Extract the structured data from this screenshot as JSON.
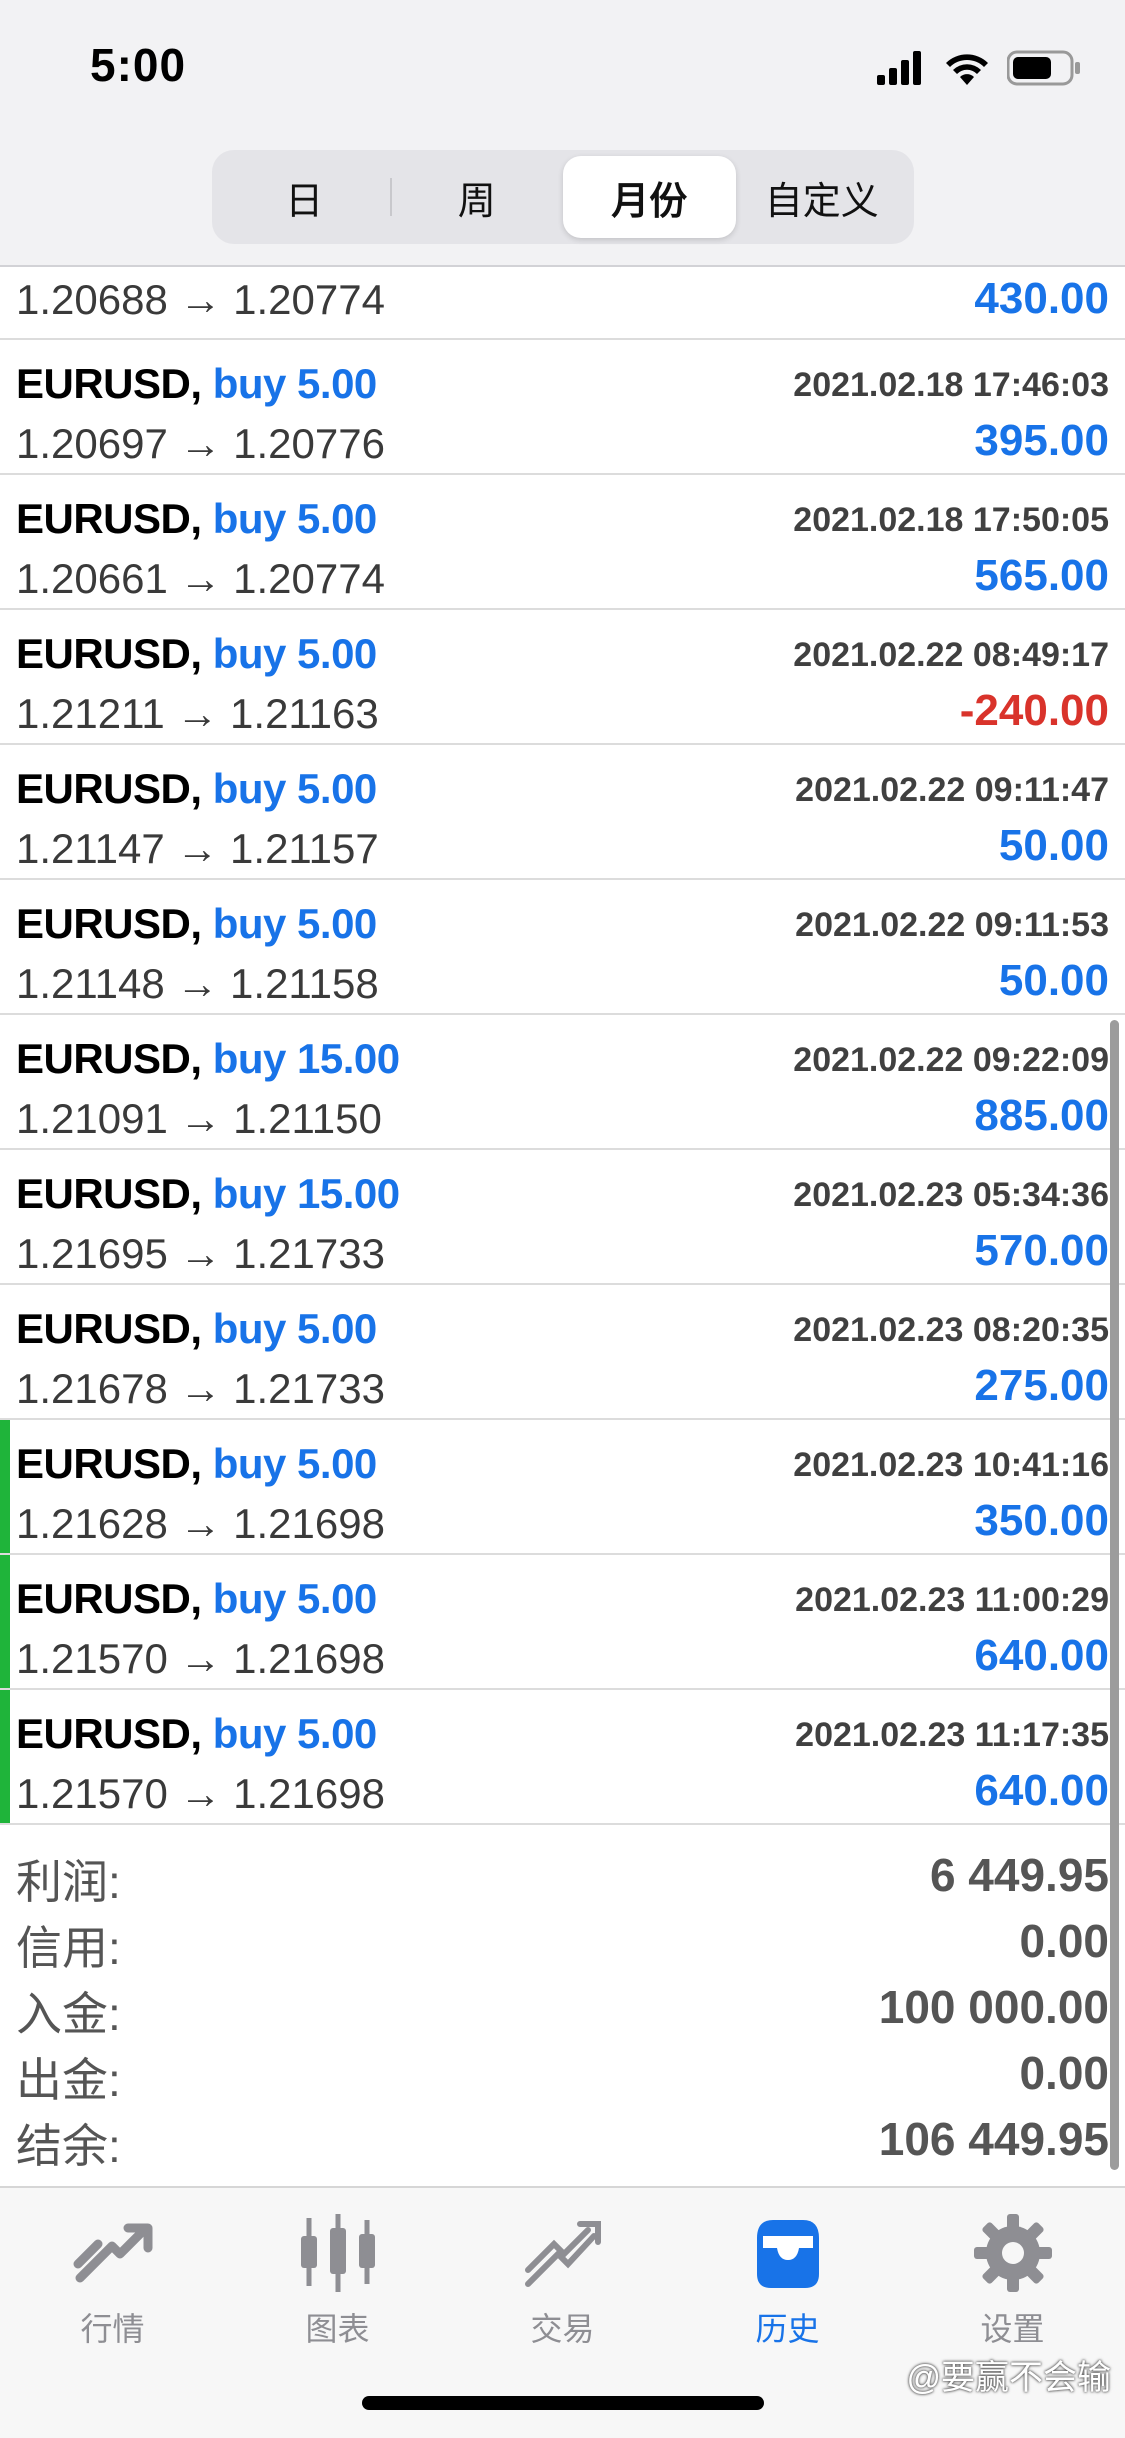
{
  "status": {
    "time": "5:00"
  },
  "segment": {
    "items": [
      {
        "label": "日"
      },
      {
        "label": "周"
      },
      {
        "label": "月份"
      },
      {
        "label": "自定义"
      }
    ],
    "selected": "月份"
  },
  "trades": [
    {
      "symbol": "",
      "side": "",
      "time": "",
      "prices": "1.20688 → 1.20774",
      "profit": "430.00",
      "negative": false,
      "marked": false,
      "partial": true
    },
    {
      "symbol": "EURUSD,",
      "side": "buy 5.00",
      "time": "2021.02.18 17:46:03",
      "prices": "1.20697 → 1.20776",
      "profit": "395.00",
      "negative": false,
      "marked": false
    },
    {
      "symbol": "EURUSD,",
      "side": "buy 5.00",
      "time": "2021.02.18 17:50:05",
      "prices": "1.20661 → 1.20774",
      "profit": "565.00",
      "negative": false,
      "marked": false
    },
    {
      "symbol": "EURUSD,",
      "side": "buy 5.00",
      "time": "2021.02.22 08:49:17",
      "prices": "1.21211 → 1.21163",
      "profit": "-240.00",
      "negative": true,
      "marked": false
    },
    {
      "symbol": "EURUSD,",
      "side": "buy 5.00",
      "time": "2021.02.22 09:11:47",
      "prices": "1.21147 → 1.21157",
      "profit": "50.00",
      "negative": false,
      "marked": false
    },
    {
      "symbol": "EURUSD,",
      "side": "buy 5.00",
      "time": "2021.02.22 09:11:53",
      "prices": "1.21148 → 1.21158",
      "profit": "50.00",
      "negative": false,
      "marked": false
    },
    {
      "symbol": "EURUSD,",
      "side": "buy 15.00",
      "time": "2021.02.22 09:22:09",
      "prices": "1.21091 → 1.21150",
      "profit": "885.00",
      "negative": false,
      "marked": false
    },
    {
      "symbol": "EURUSD,",
      "side": "buy 15.00",
      "time": "2021.02.23 05:34:36",
      "prices": "1.21695 → 1.21733",
      "profit": "570.00",
      "negative": false,
      "marked": false
    },
    {
      "symbol": "EURUSD,",
      "side": "buy 5.00",
      "time": "2021.02.23 08:20:35",
      "prices": "1.21678 → 1.21733",
      "profit": "275.00",
      "negative": false,
      "marked": false
    },
    {
      "symbol": "EURUSD,",
      "side": "buy 5.00",
      "time": "2021.02.23 10:41:16",
      "prices": "1.21628 → 1.21698",
      "profit": "350.00",
      "negative": false,
      "marked": true
    },
    {
      "symbol": "EURUSD,",
      "side": "buy 5.00",
      "time": "2021.02.23 11:00:29",
      "prices": "1.21570 → 1.21698",
      "profit": "640.00",
      "negative": false,
      "marked": true
    },
    {
      "symbol": "EURUSD,",
      "side": "buy 5.00",
      "time": "2021.02.23 11:17:35",
      "prices": "1.21570 → 1.21698",
      "profit": "640.00",
      "negative": false,
      "marked": true
    }
  ],
  "summary": [
    {
      "label": "利润:",
      "value": "6 449.95"
    },
    {
      "label": "信用:",
      "value": "0.00"
    },
    {
      "label": "入金:",
      "value": "100 000.00"
    },
    {
      "label": "出金:",
      "value": "0.00"
    },
    {
      "label": "结余:",
      "value": "106 449.95"
    }
  ],
  "tabs": [
    {
      "label": "行情",
      "icon": "quotes-icon",
      "active": false
    },
    {
      "label": "图表",
      "icon": "chart-icon",
      "active": false
    },
    {
      "label": "交易",
      "icon": "trade-icon",
      "active": false
    },
    {
      "label": "历史",
      "icon": "history-icon",
      "active": true
    },
    {
      "label": "设置",
      "icon": "settings-icon",
      "active": false
    }
  ],
  "watermark": "@要赢不会输",
  "colors": {
    "accent_blue": "#1873e8",
    "loss_red": "#d9332b",
    "marker_green": "#1fb43a",
    "tab_inactive": "#8e8e93"
  }
}
